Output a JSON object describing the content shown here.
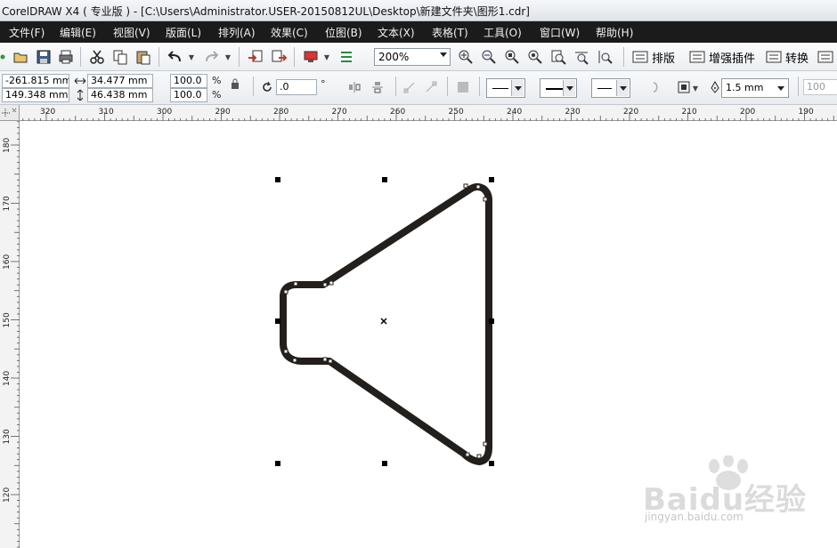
{
  "window": {
    "title": "CorelDRAW X4 ( 专业版 ) - [C:\\Users\\Administrator.USER-20150812UL\\Desktop\\新建文件夹\\图形1.cdr]"
  },
  "menu": {
    "items": [
      "文件(F)",
      "编辑(E)",
      "视图(V)",
      "版面(L)",
      "排列(A)",
      "效果(C)",
      "位图(B)",
      "文本(X)",
      "表格(T)",
      "工具(O)",
      "窗口(W)",
      "帮助(H)"
    ]
  },
  "toolbar": {
    "zoom_level": "200%",
    "plugins": [
      "排版",
      "增强插件",
      "转换"
    ]
  },
  "property_bar": {
    "x_position": "-261.815 mm",
    "y_position": "149.348 mm",
    "width": "34.477 mm",
    "height": "46.438 mm",
    "scale_x": "100.0",
    "scale_y": "100.0",
    "percent": "%",
    "rotation": ".0",
    "degree": "°",
    "outline_width": "1.5 mm",
    "extra_value": "100"
  },
  "rulers": {
    "horizontal_labels": [
      "320",
      "310",
      "300",
      "290",
      "280",
      "270",
      "260",
      "250",
      "240",
      "230",
      "220",
      "210",
      "200",
      "190"
    ],
    "vertical_labels": [
      "180",
      "170",
      "160",
      "150",
      "140",
      "130",
      "120"
    ]
  },
  "watermark": {
    "brand": "Baidu经验",
    "site": "jingyan.baidu.com"
  },
  "colors": {
    "menu_bg": "#1b1b1b",
    "shape_stroke": "#231f1c",
    "handle": "#000000"
  }
}
